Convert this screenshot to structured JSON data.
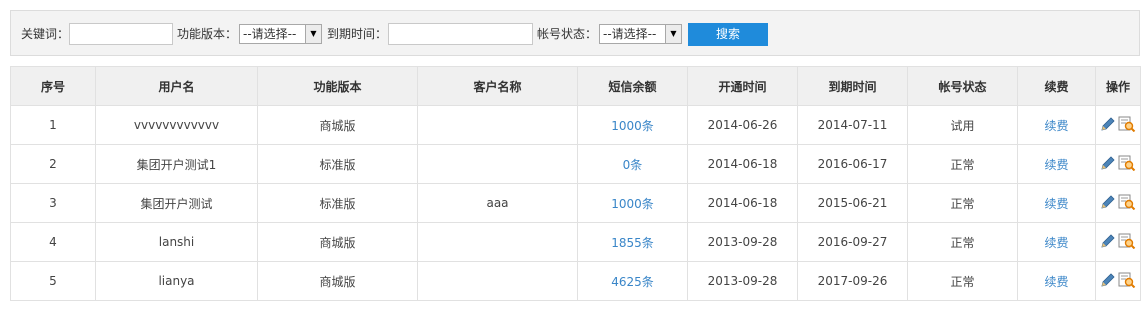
{
  "filters": {
    "keyword_label": "关键词：",
    "keyword_value": "",
    "version_label": "功能版本：",
    "version_selected": "--请选择--",
    "expire_label": "到期时间：",
    "expire_value": "",
    "status_label": "帐号状态：",
    "status_selected": "--请选择--",
    "search_button": "搜索"
  },
  "table": {
    "headers": [
      "序号",
      "用户名",
      "功能版本",
      "客户名称",
      "短信余额",
      "开通时间",
      "到期时间",
      "帐号状态",
      "续费",
      "操作"
    ],
    "rows": [
      {
        "no": "1",
        "username": "vvvvvvvvvvvv",
        "version": "商城版",
        "customer": "",
        "sms": "1000条",
        "open": "2014-06-26",
        "expire": "2014-07-11",
        "status": "试用",
        "renew": "续费"
      },
      {
        "no": "2",
        "username": "集团开户测试1",
        "version": "标准版",
        "customer": "",
        "sms": "0条",
        "open": "2014-06-18",
        "expire": "2016-06-17",
        "status": "正常",
        "renew": "续费"
      },
      {
        "no": "3",
        "username": "集团开户测试",
        "version": "标准版",
        "customer": "aaa",
        "sms": "1000条",
        "open": "2014-06-18",
        "expire": "2015-06-21",
        "status": "正常",
        "renew": "续费"
      },
      {
        "no": "4",
        "username": "lanshi",
        "version": "商城版",
        "customer": "",
        "sms": "1855条",
        "open": "2013-09-28",
        "expire": "2016-09-27",
        "status": "正常",
        "renew": "续费"
      },
      {
        "no": "5",
        "username": "lianya",
        "version": "商城版",
        "customer": "",
        "sms": "4625条",
        "open": "2013-09-28",
        "expire": "2017-09-26",
        "status": "正常",
        "renew": "续费"
      }
    ],
    "row_actions": [
      "edit-icon",
      "view-details-icon"
    ]
  },
  "colors": {
    "link": "#3a86c8",
    "search_button": "#1f8bdb",
    "header_bg": "#f0f0f0"
  }
}
